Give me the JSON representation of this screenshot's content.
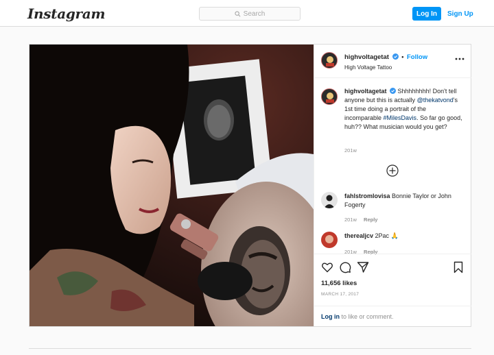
{
  "nav": {
    "logo": "Instagram",
    "search_placeholder": "Search",
    "login_label": "Log In",
    "signup_label": "Sign Up"
  },
  "post": {
    "username": "highvoltagetat",
    "follow_label": "Follow",
    "separator": "•",
    "subtitle": "High Voltage Tattoo",
    "caption": {
      "username": "highvoltagetat",
      "text_1": "Shhhhhhhh! Don't tell anyone but this is actually",
      "mention": "@thekatvond",
      "text_2": "'s 1st time doing a portrait of the incomparable",
      "hashtag": "#MilesDavis",
      "text_3": ". So far go good, huh?? What musician would you get?",
      "time": "201w"
    },
    "comments": [
      {
        "username": "fahlstromlovisa",
        "text": "Bonnie Taylor or John Fogerty",
        "time": "201w",
        "reply_label": "Reply"
      },
      {
        "username": "therealjcv",
        "text": "2Pac 🙏",
        "time": "201w",
        "reply_label": "Reply"
      }
    ],
    "likes": "11,656 likes",
    "date": "MARCH 17, 2017",
    "login_link": "Log in",
    "login_suffix": " to like or comment."
  },
  "icons": {
    "search": "search-icon",
    "verified": "verified-badge-icon",
    "more": "more-options-icon",
    "load_more": "plus-circle-icon",
    "like": "heart-icon",
    "comment": "comment-icon",
    "share": "share-icon",
    "save": "bookmark-icon"
  },
  "colors": {
    "accent": "#0095f6",
    "link": "#00376b",
    "muted": "#8e8e8e",
    "border": "#dbdbdb"
  }
}
